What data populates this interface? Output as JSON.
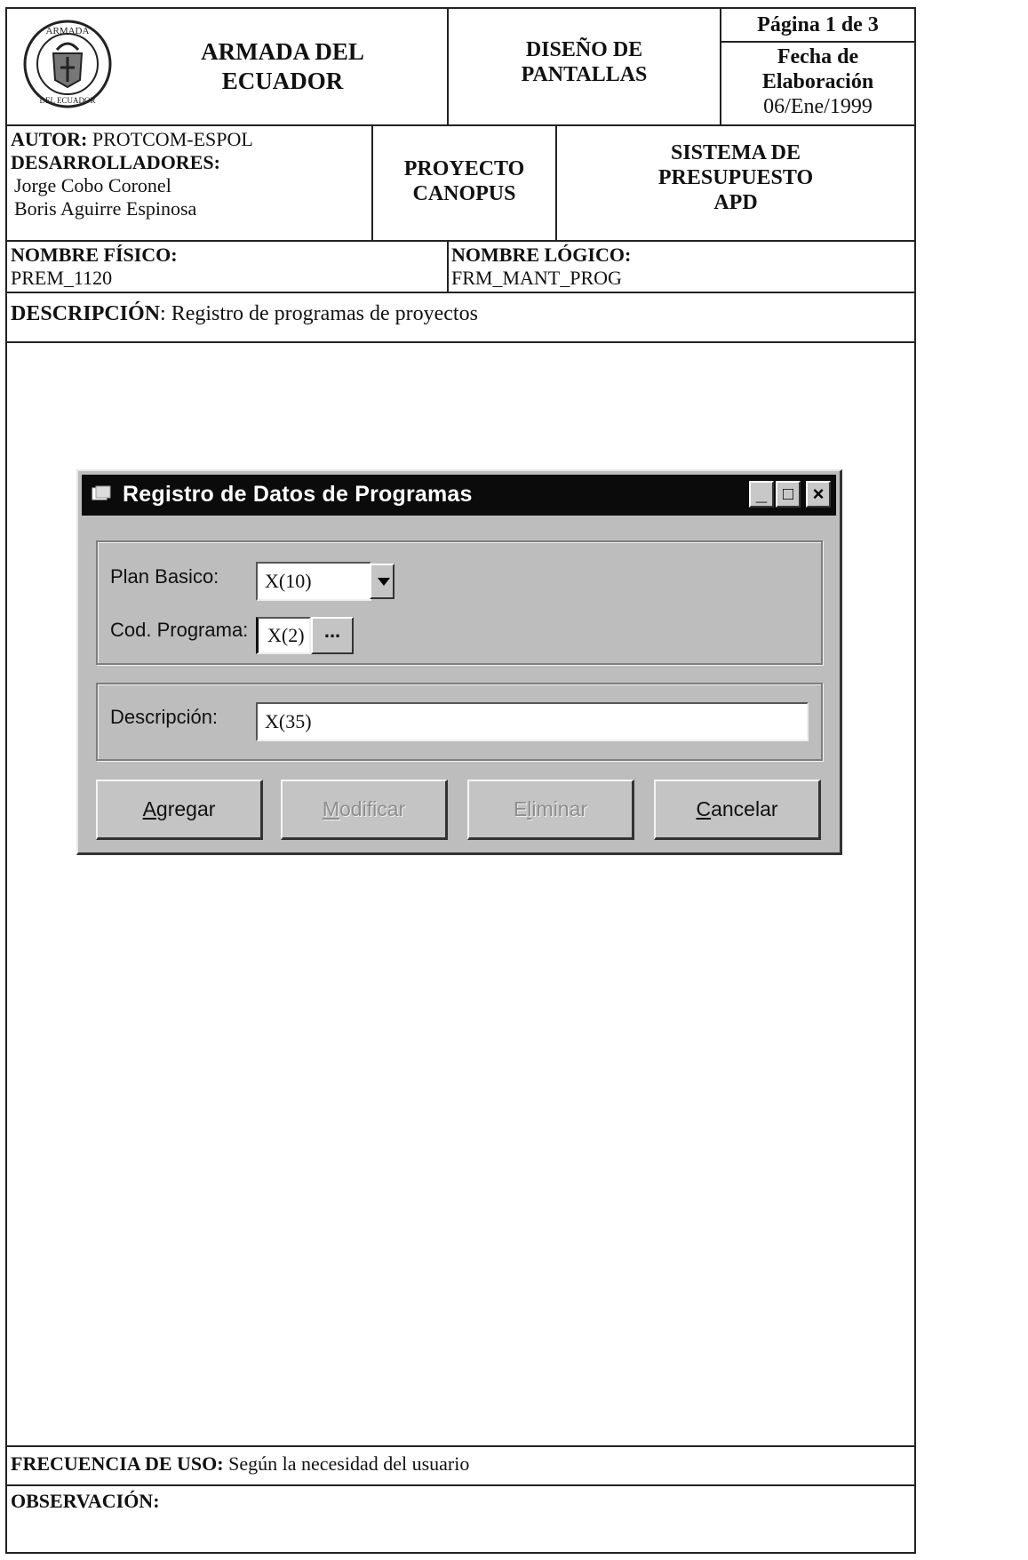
{
  "header": {
    "org_line1": "ARMADA DEL",
    "org_line2": "ECUADOR",
    "doc_type_line1": "DISEÑO DE",
    "doc_type_line2": "PANTALLAS",
    "page_info": "Página 1 de 3",
    "date_label_line1": "Fecha de",
    "date_label_line2": "Elaboración",
    "date_value": "06/Ene/1999",
    "seal_text_top": "ARMADA",
    "seal_text_bottom": "DEL ECUADOR"
  },
  "authors": {
    "autor_label": "AUTOR:",
    "autor_value": "PROTCOM-ESPOL",
    "devs_label": "DESARROLLADORES:",
    "dev1": "Jorge Cobo Coronel",
    "dev2": "Boris Aguirre Espinosa"
  },
  "project": {
    "line1": "PROYECTO",
    "line2": "CANOPUS"
  },
  "system": {
    "line1": "SISTEMA DE",
    "line2": "PRESUPUESTO",
    "line3": "APD"
  },
  "names": {
    "physical_label": "NOMBRE FÍSICO:",
    "physical_value": "PREM_1120",
    "logical_label": "NOMBRE LÓGICO:",
    "logical_value": "FRM_MANT_PROG"
  },
  "description": {
    "label": "DESCRIPCIÓN",
    "value": ":  Registro de programas de proyectos"
  },
  "dialog": {
    "title": "Registro de Datos de Programas",
    "minimize": "_",
    "maximize": "□",
    "close": "×",
    "plan_label": "Plan Basico:",
    "plan_value": "X(10)",
    "cod_label": "Cod. Programa:",
    "cod_value": "X(2)",
    "browse_label": "...",
    "desc_label": "Descripción:",
    "desc_value": "X(35)",
    "buttons": {
      "add_key": "A",
      "add_rest": "gregar",
      "modify_key": "M",
      "modify_rest": "odificar",
      "delete_pre": "E",
      "delete_key": "l",
      "delete_rest": "iminar",
      "cancel_key": "C",
      "cancel_rest": "ancelar"
    }
  },
  "footer": {
    "freq_label": "FRECUENCIA DE USO:",
    "freq_value": " Según la necesidad del usuario",
    "obs_label": "OBSERVACIÓN:"
  }
}
